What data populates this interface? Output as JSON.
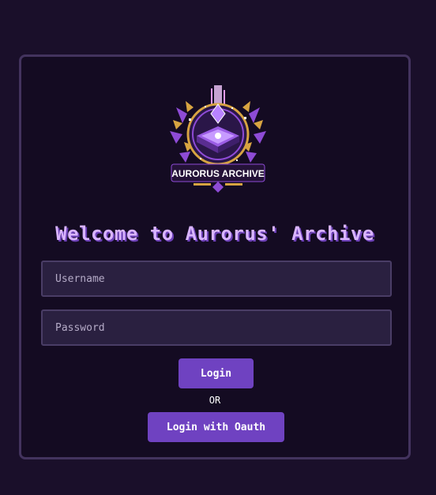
{
  "logo": {
    "icon": "aurorus-archive-logo",
    "text": "AURORUS ARCHIVE"
  },
  "title": "Welcome to Aurorus' Archive",
  "form": {
    "username_placeholder": "Username",
    "username_value": "",
    "password_placeholder": "Password",
    "password_value": "",
    "login_label": "Login",
    "or_label": "OR",
    "oauth_label": "Login with Oauth"
  },
  "colors": {
    "background": "#1a0f2a",
    "panel": "#140b22",
    "accent": "#6f42c1",
    "title": "#d9b4ff"
  }
}
